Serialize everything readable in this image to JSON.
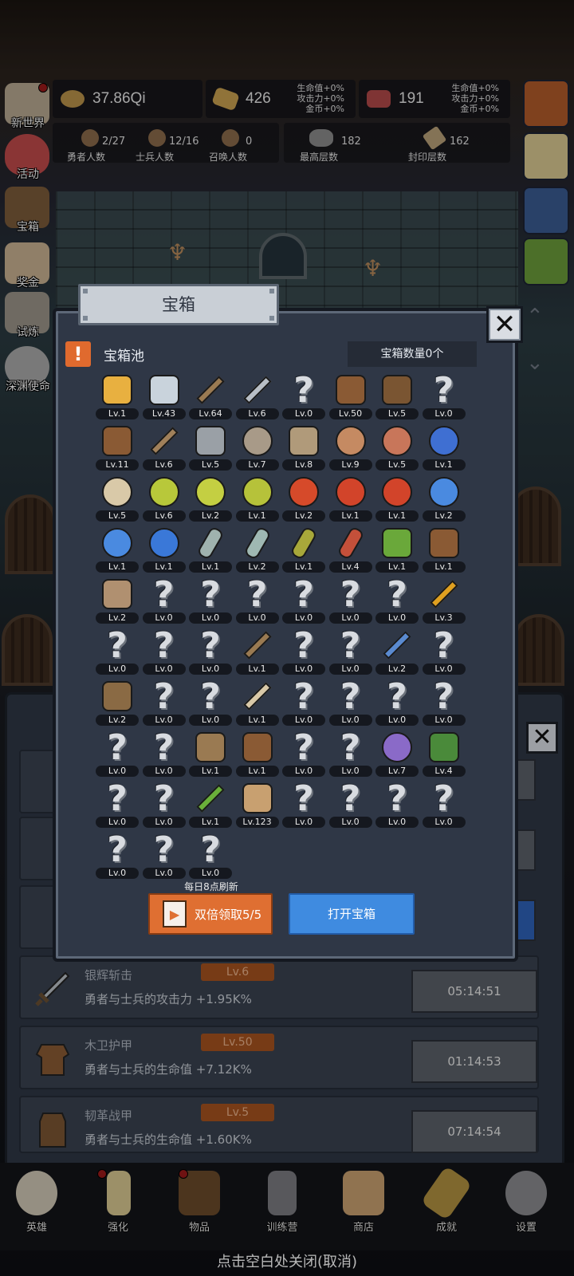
{
  "resources": {
    "qi": {
      "value": "37.86Qi"
    },
    "gold_bar": {
      "value": "426",
      "bonus": [
        "生命值+0%",
        "攻击力+0%",
        "金币+0%"
      ]
    },
    "meat": {
      "value": "191",
      "bonus": [
        "生命值+0%",
        "攻击力+0%",
        "金币+0%"
      ]
    }
  },
  "stats": [
    {
      "value": "2/27",
      "label": "勇者人数"
    },
    {
      "value": "12/16",
      "label": "士兵人数"
    },
    {
      "value": "0",
      "label": "召唤人数"
    },
    {
      "value": "182",
      "label": "最高层数"
    },
    {
      "value": "162",
      "label": "封印层数"
    }
  ],
  "side_menu": [
    "新世界",
    "活动",
    "宝箱",
    "奖金",
    "试炼",
    "深渊使命"
  ],
  "dialog": {
    "title": "宝箱",
    "pool_label": "宝箱池",
    "chest_count": "宝箱数量0个",
    "refresh_note": "每日8点刷新",
    "double_button": "双倍领取5/5",
    "open_button": "打开宝箱",
    "items": [
      {
        "icon": "crown-icon",
        "color": "#e8b040",
        "level": "Lv.1"
      },
      {
        "icon": "diamond-icon",
        "color": "#c9d3dc",
        "level": "Lv.43"
      },
      {
        "icon": "wooden-sword-icon",
        "color": "#9a7a52",
        "level": "Lv.64"
      },
      {
        "icon": "silver-sword-icon",
        "color": "#b9bfc6",
        "level": "Lv.6"
      },
      {
        "icon": "unknown-item-icon",
        "color": "",
        "level": "Lv.0"
      },
      {
        "icon": "wooden-armor-icon",
        "color": "#8a5a34",
        "level": "Lv.50"
      },
      {
        "icon": "leather-armor-icon",
        "color": "#7a5532",
        "level": "Lv.5"
      },
      {
        "icon": "unknown-item-icon",
        "color": "",
        "level": "Lv.0"
      },
      {
        "icon": "leather-helmet-icon",
        "color": "#8a5a34",
        "level": "Lv.11"
      },
      {
        "icon": "dagger-icon",
        "color": "#a0805a",
        "level": "Lv.6"
      },
      {
        "icon": "iron-helmet-icon",
        "color": "#9aa0a6",
        "level": "Lv.5"
      },
      {
        "icon": "hammer-icon",
        "color": "#a89a88",
        "level": "Lv.7"
      },
      {
        "icon": "knight-helmet-icon",
        "color": "#b09a7a",
        "level": "Lv.8"
      },
      {
        "icon": "ham-icon",
        "color": "#c58a62",
        "level": "Lv.9"
      },
      {
        "icon": "steak-icon",
        "color": "#c8765a",
        "level": "Lv.5"
      },
      {
        "icon": "blue-pouch-icon",
        "color": "#3f6fd2",
        "level": "Lv.1"
      },
      {
        "icon": "bread-icon",
        "color": "#d9c9a8",
        "level": "Lv.5"
      },
      {
        "icon": "yellow-potion-icon",
        "color": "#b8c83a",
        "level": "Lv.6"
      },
      {
        "icon": "yellow-potion-icon",
        "color": "#c4cf42",
        "level": "Lv.2"
      },
      {
        "icon": "yellow-potion-icon",
        "color": "#b6c23a",
        "level": "Lv.1"
      },
      {
        "icon": "red-potion-icon",
        "color": "#d64a2a",
        "level": "Lv.2"
      },
      {
        "icon": "red-potion-icon",
        "color": "#d2442a",
        "level": "Lv.1"
      },
      {
        "icon": "red-potion-icon",
        "color": "#d2442a",
        "level": "Lv.1"
      },
      {
        "icon": "blue-potion-icon",
        "color": "#4a8ae0",
        "level": "Lv.2"
      },
      {
        "icon": "blue-potion-icon",
        "color": "#4a8ae0",
        "level": "Lv.1"
      },
      {
        "icon": "blue-potion-icon",
        "color": "#3a78d8",
        "level": "Lv.1"
      },
      {
        "icon": "gray-vial-icon",
        "color": "#9fb2ae",
        "level": "Lv.1"
      },
      {
        "icon": "gray-vial-icon",
        "color": "#9fb8b2",
        "level": "Lv.2"
      },
      {
        "icon": "yellow-bottle-icon",
        "color": "#a8a83a",
        "level": "Lv.1"
      },
      {
        "icon": "red-bottle-icon",
        "color": "#c4503a",
        "level": "Lv.4"
      },
      {
        "icon": "green-boot-icon",
        "color": "#6aa83a",
        "level": "Lv.1"
      },
      {
        "icon": "brown-boot-icon",
        "color": "#8a5a34",
        "level": "Lv.1"
      },
      {
        "icon": "leather-boot-icon",
        "color": "#b09070",
        "level": "Lv.2"
      },
      {
        "icon": "unknown-item-icon",
        "color": "",
        "level": "Lv.0"
      },
      {
        "icon": "unknown-item-icon",
        "color": "",
        "level": "Lv.0"
      },
      {
        "icon": "unknown-item-icon",
        "color": "",
        "level": "Lv.0"
      },
      {
        "icon": "unknown-item-icon",
        "color": "",
        "level": "Lv.0"
      },
      {
        "icon": "unknown-item-icon",
        "color": "",
        "level": "Lv.0"
      },
      {
        "icon": "unknown-item-icon",
        "color": "",
        "level": "Lv.0"
      },
      {
        "icon": "torch-icon",
        "color": "#e0a020",
        "level": "Lv.3"
      },
      {
        "icon": "unknown-item-icon",
        "color": "",
        "level": "Lv.0"
      },
      {
        "icon": "unknown-item-icon",
        "color": "",
        "level": "Lv.0"
      },
      {
        "icon": "unknown-item-icon",
        "color": "",
        "level": "Lv.0"
      },
      {
        "icon": "wooden-staff-icon",
        "color": "#9a7a52",
        "level": "Lv.1"
      },
      {
        "icon": "unknown-item-icon",
        "color": "",
        "level": "Lv.0"
      },
      {
        "icon": "unknown-item-icon",
        "color": "",
        "level": "Lv.0"
      },
      {
        "icon": "blue-wand-icon",
        "color": "#5a8ad0",
        "level": "Lv.2"
      },
      {
        "icon": "unknown-item-icon",
        "color": "",
        "level": "Lv.0"
      },
      {
        "icon": "backpack-icon",
        "color": "#8a6a44",
        "level": "Lv.2"
      },
      {
        "icon": "unknown-item-icon",
        "color": "",
        "level": "Lv.0"
      },
      {
        "icon": "unknown-item-icon",
        "color": "",
        "level": "Lv.0"
      },
      {
        "icon": "bone-club-icon",
        "color": "#d9c9a8",
        "level": "Lv.1"
      },
      {
        "icon": "unknown-item-icon",
        "color": "",
        "level": "Lv.0"
      },
      {
        "icon": "unknown-item-icon",
        "color": "",
        "level": "Lv.0"
      },
      {
        "icon": "unknown-item-icon",
        "color": "",
        "level": "Lv.0"
      },
      {
        "icon": "unknown-item-icon",
        "color": "",
        "level": "Lv.0"
      },
      {
        "icon": "unknown-item-icon",
        "color": "",
        "level": "Lv.0"
      },
      {
        "icon": "unknown-item-icon",
        "color": "",
        "level": "Lv.0"
      },
      {
        "icon": "bow-icon",
        "color": "#9a7a52",
        "level": "Lv.1"
      },
      {
        "icon": "quiver-icon",
        "color": "#8a5a34",
        "level": "Lv.1"
      },
      {
        "icon": "unknown-item-icon",
        "color": "",
        "level": "Lv.0"
      },
      {
        "icon": "unknown-item-icon",
        "color": "",
        "level": "Lv.0"
      },
      {
        "icon": "tentacle-orb-icon",
        "color": "#8a6ac8",
        "level": "Lv.7"
      },
      {
        "icon": "green-shield-icon",
        "color": "#4a8a3a",
        "level": "Lv.4"
      },
      {
        "icon": "unknown-item-icon",
        "color": "",
        "level": "Lv.0"
      },
      {
        "icon": "unknown-item-icon",
        "color": "",
        "level": "Lv.0"
      },
      {
        "icon": "green-wand-icon",
        "color": "#6ab03a",
        "level": "Lv.1"
      },
      {
        "icon": "beer-mug-icon",
        "color": "#c8a070",
        "level": "Lv.123"
      },
      {
        "icon": "unknown-item-icon",
        "color": "",
        "level": "Lv.0"
      },
      {
        "icon": "unknown-item-icon",
        "color": "",
        "level": "Lv.0"
      },
      {
        "icon": "unknown-item-icon",
        "color": "",
        "level": "Lv.0"
      },
      {
        "icon": "unknown-item-icon",
        "color": "",
        "level": "Lv.0"
      },
      {
        "icon": "unknown-item-icon",
        "color": "",
        "level": "Lv.0"
      },
      {
        "icon": "unknown-item-icon",
        "color": "",
        "level": "Lv.0"
      },
      {
        "icon": "unknown-item-icon",
        "color": "",
        "level": "Lv.0"
      }
    ]
  },
  "background_list": [
    {
      "name": "银辉斩击",
      "level": "Lv.6",
      "desc": "勇者与士兵的攻击力 +1.95K%",
      "timer": "05:14:51",
      "icon": "silver-sword-icon"
    },
    {
      "name": "木卫护甲",
      "level": "Lv.50",
      "desc": "勇者与士兵的生命值 +7.12K%",
      "timer": "01:14:53",
      "icon": "wooden-armor-icon"
    },
    {
      "name": "韧革战甲",
      "level": "Lv.5",
      "desc": "勇者与士兵的生命值 +1.60K%",
      "timer": "07:14:54",
      "icon": "leather-armor-icon"
    }
  ],
  "bottom_nav": [
    "英雄",
    "强化",
    "物品",
    "训练营",
    "商店",
    "成就",
    "设置"
  ],
  "close_hint": "点击空白处关闭(取消)"
}
